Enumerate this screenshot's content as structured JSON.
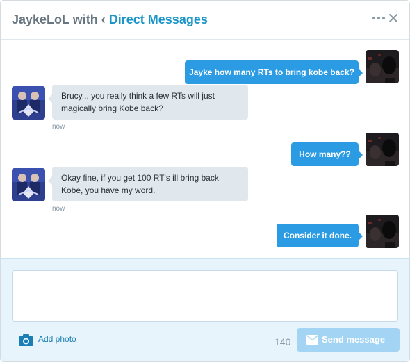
{
  "header": {
    "participant": "JaykeLoL",
    "with_text": "with",
    "back_chevron": "‹",
    "back_link": "Direct Messages",
    "more_icon": "ellipsis-icon",
    "close_icon": "close-icon"
  },
  "colors": {
    "accent": "#1b95c7",
    "sent_bubble": "#2b9be3",
    "received_bubble": "#e1e8ed",
    "composer_bg": "#e8f4fb",
    "send_button_disabled": "#a4d4f3"
  },
  "messages": [
    {
      "direction": "sent",
      "text": "Jayke how many RTs to bring kobe back?",
      "avatar": "jayke-avatar"
    },
    {
      "direction": "received",
      "lines": [
        "Brucy... you really think a few RTs will just",
        "magically bring Kobe back?"
      ],
      "time": "now",
      "avatar": "brucy-avatar"
    },
    {
      "direction": "sent",
      "text": "How many??",
      "avatar": "jayke-avatar"
    },
    {
      "direction": "received",
      "lines": [
        "Okay fine, if you get 100 RT's ill bring back",
        "Kobe, you have my word."
      ],
      "time": "now",
      "avatar": "brucy-avatar"
    },
    {
      "direction": "sent",
      "text": "Consider it done.",
      "avatar": "jayke-avatar"
    }
  ],
  "composer": {
    "input_value": "",
    "add_photo_label": "Add photo",
    "camera_icon": "camera-icon",
    "char_count": "140",
    "send_label": "Send message",
    "send_icon": "envelope-icon"
  }
}
